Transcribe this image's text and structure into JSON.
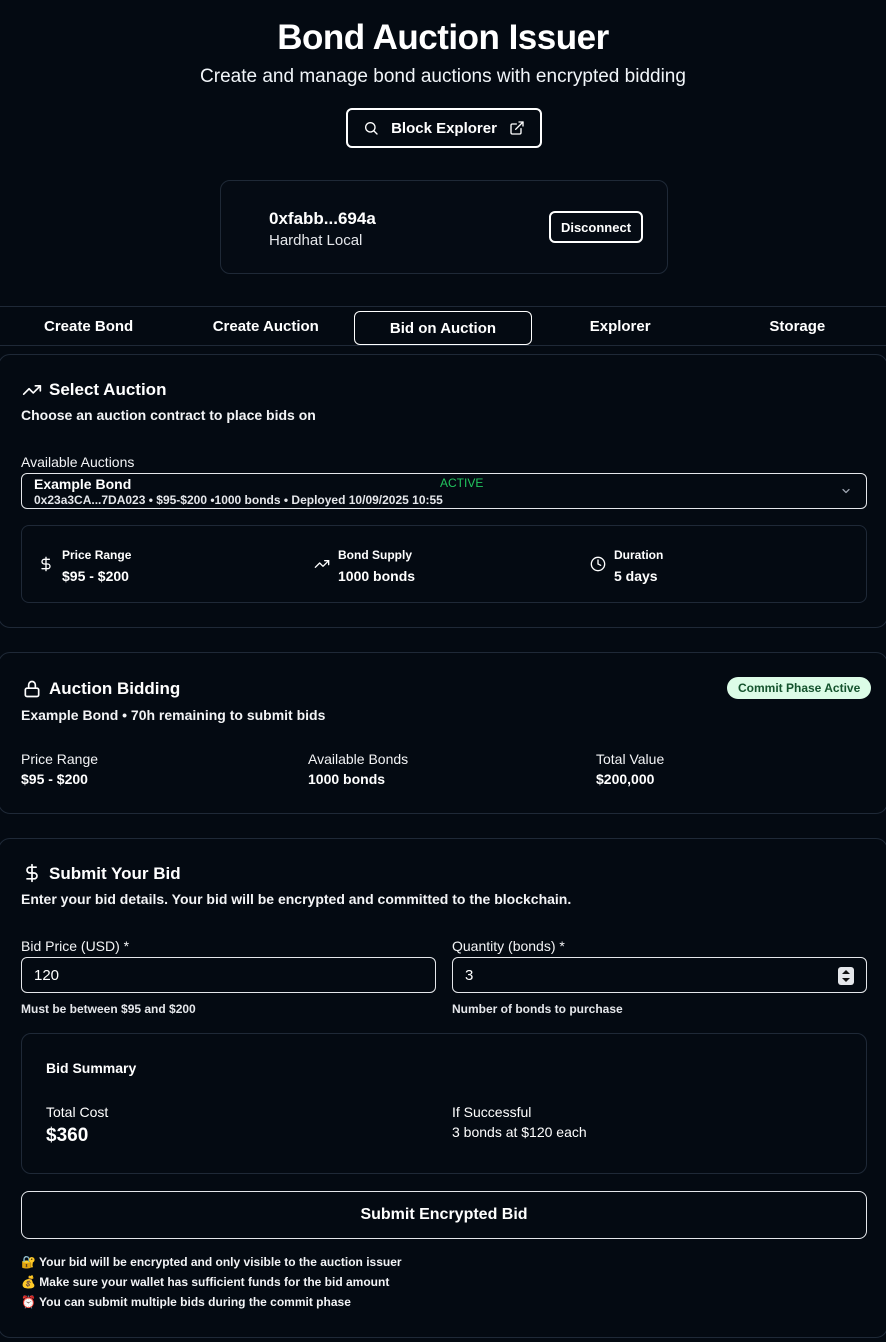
{
  "header": {
    "title": "Bond Auction Issuer",
    "subtitle": "Create and manage bond auctions with encrypted bidding",
    "explorer_button": "Block Explorer"
  },
  "wallet": {
    "address": "0xfabb...694a",
    "network": "Hardhat Local",
    "disconnect_label": "Disconnect"
  },
  "tabs": [
    {
      "label": "Create Bond",
      "active": false
    },
    {
      "label": "Create Auction",
      "active": false
    },
    {
      "label": "Bid on Auction",
      "active": true
    },
    {
      "label": "Explorer",
      "active": false
    },
    {
      "label": "Storage",
      "active": false
    }
  ],
  "select_auction": {
    "title": "Select Auction",
    "description": "Choose an auction contract to place bids on",
    "field_label": "Available Auctions",
    "selected": {
      "name": "Example Bond",
      "status": "ACTIVE",
      "detail": "0x23a3CA...7DA023 • $95-$200 •1000 bonds • Deployed 10/09/2025 10:55"
    },
    "info": [
      {
        "key": "Price Range",
        "value": "$95 - $200",
        "icon": "dollar-icon"
      },
      {
        "key": "Bond Supply",
        "value": "1000 bonds",
        "icon": "trending-up-icon"
      },
      {
        "key": "Duration",
        "value": "5 days",
        "icon": "clock-icon"
      }
    ]
  },
  "bidding": {
    "title": "Auction Bidding",
    "subtitle": "Example Bond • 70h remaining to submit bids",
    "badge": "Commit Phase Active",
    "stats": [
      {
        "label": "Price Range",
        "value": "$95 - $200"
      },
      {
        "label": "Available Bonds",
        "value": "1000 bonds"
      },
      {
        "label": "Total Value",
        "value": "$200,000"
      }
    ]
  },
  "submit": {
    "title": "Submit Your Bid",
    "description": "Enter your bid details. Your bid will be encrypted and committed to the blockchain.",
    "price_label": "Bid Price (USD) *",
    "price_value": "120",
    "price_hint": "Must be between $95 and $200",
    "qty_label": "Quantity (bonds) *",
    "qty_value": "3",
    "qty_hint": "Number of bonds to purchase",
    "summary": {
      "title": "Bid Summary",
      "total_label": "Total Cost",
      "total_value": "$360",
      "success_label": "If Successful",
      "success_value": "3 bonds at $120 each"
    },
    "button": "Submit Encrypted Bid",
    "notes": [
      "🔐 Your bid will be encrypted and only visible to the auction issuer",
      "💰 Make sure your wallet has sufficient funds for the bid amount",
      "⏰ You can submit multiple bids during the commit phase"
    ]
  },
  "colors": {
    "background": "#040a12",
    "border": "#1f2937",
    "active_status": "#22c55e",
    "badge_bg": "#dcfce7",
    "badge_text": "#14532d"
  }
}
